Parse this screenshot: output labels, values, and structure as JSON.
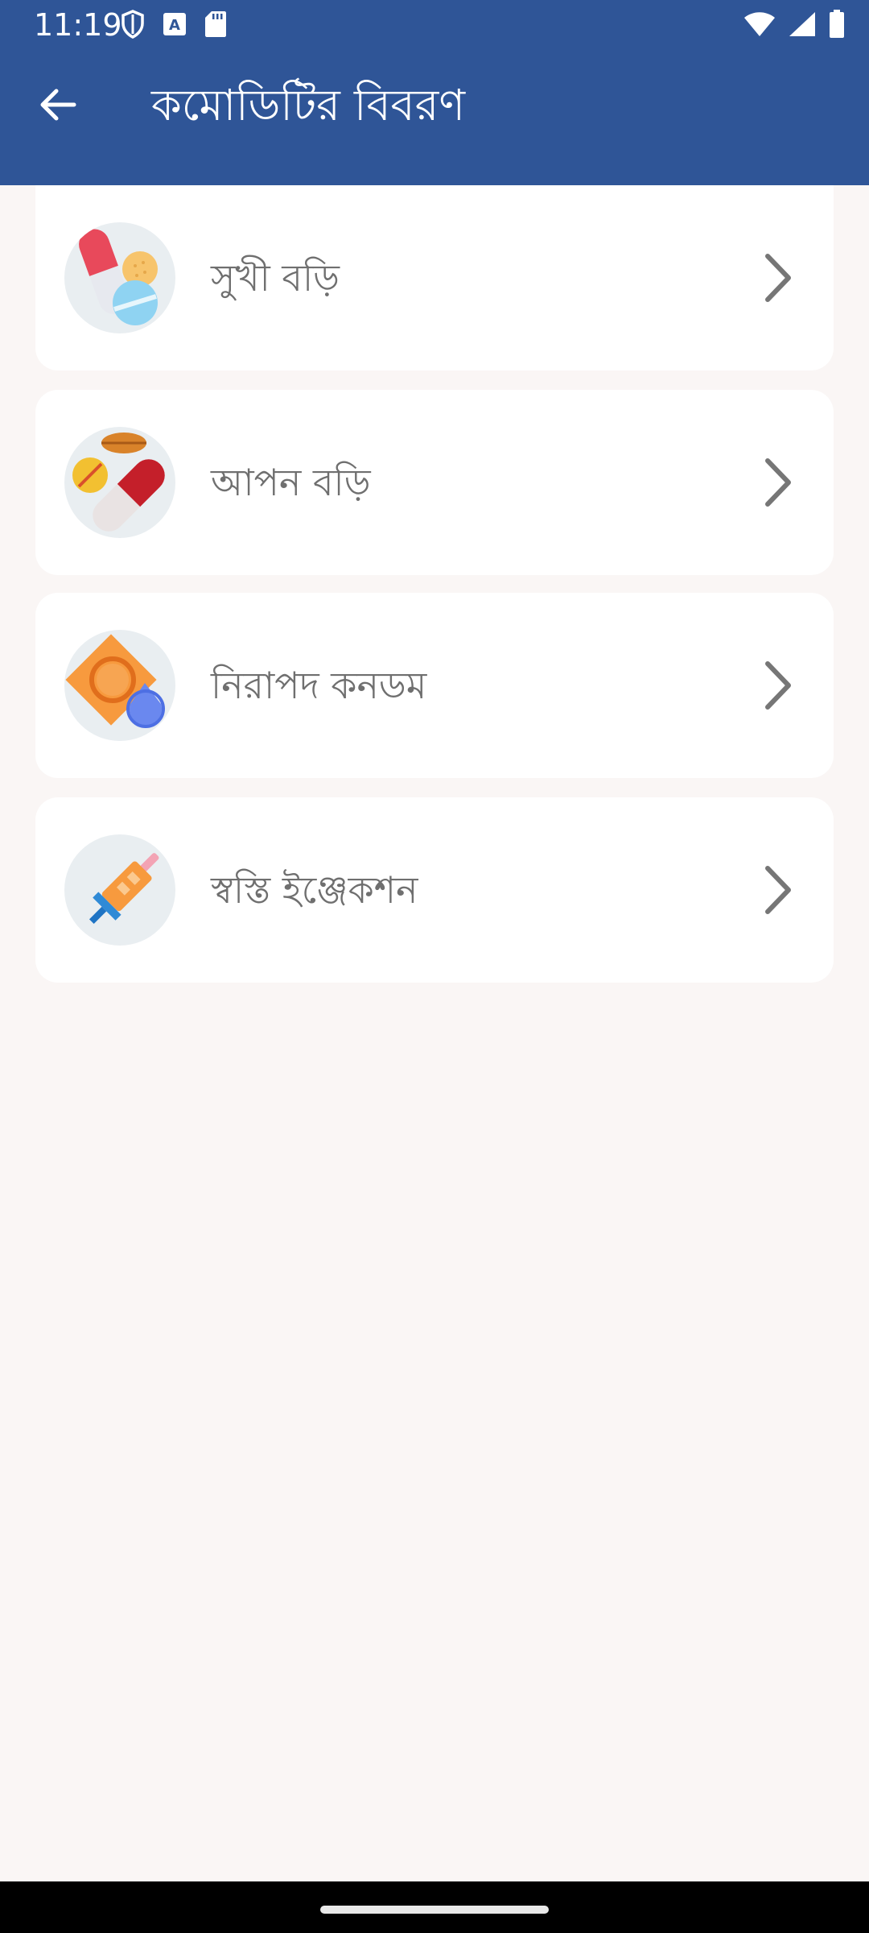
{
  "status_bar": {
    "time": "11:19",
    "left_icons": [
      "shield-icon",
      "text-a-icon",
      "sd-card-icon"
    ],
    "right_icons": [
      "wifi-icon",
      "signal-icon",
      "battery-icon"
    ]
  },
  "app_bar": {
    "title": "কমোডিটির বিবরণ",
    "back_icon": "arrow-left-icon",
    "color": "#2f5597"
  },
  "commodities": [
    {
      "label": "সুখী বড়ি",
      "icon": "pills-icon"
    },
    {
      "label": "আপন বড়ি",
      "icon": "pills-capsule-icon"
    },
    {
      "label": "নিরাপদ কনডম",
      "icon": "condom-icon"
    },
    {
      "label": "স্বস্তি ইঞ্জেকশন",
      "icon": "injection-icon"
    }
  ]
}
